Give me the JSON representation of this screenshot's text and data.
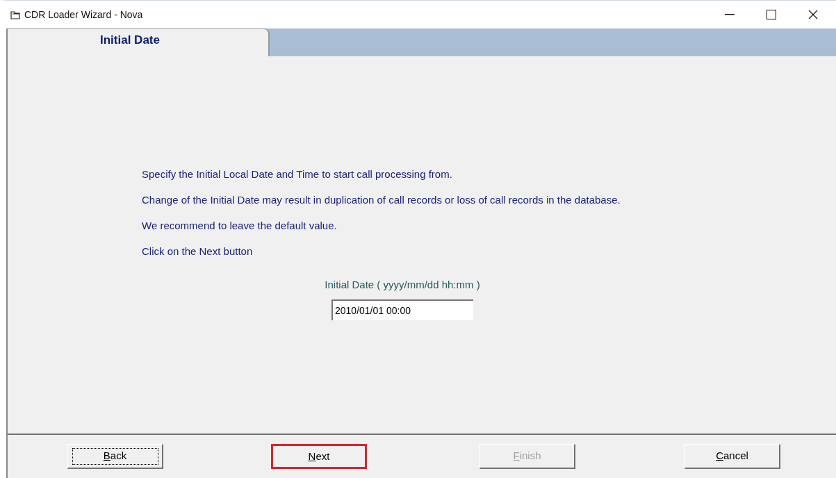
{
  "window": {
    "title": "CDR Loader Wizard - Nova"
  },
  "tabs": [
    {
      "label": "Initial Date",
      "selected": true
    }
  ],
  "paragraphs": [
    "Specify the Initial Local Date and Time to start call processing from.",
    "Change of the Initial Date may result in duplication of call records or loss of call records in the database.",
    "We recommend to leave the default value.",
    "Click on the Next button"
  ],
  "date_field": {
    "label": "Initial Date ( yyyy/mm/dd hh:mm )",
    "value": "2010/01/01 00:00"
  },
  "buttons": [
    {
      "label": "Back",
      "access_key": true,
      "focused": true,
      "disabled": false,
      "highlighted": false
    },
    {
      "label": "Next",
      "access_key": true,
      "focused": false,
      "disabled": false,
      "highlighted": true
    },
    {
      "label": "Finish",
      "access_key": true,
      "focused": false,
      "disabled": true,
      "highlighted": false
    },
    {
      "label": "Cancel",
      "access_key": true,
      "focused": false,
      "disabled": false,
      "highlighted": false
    }
  ]
}
